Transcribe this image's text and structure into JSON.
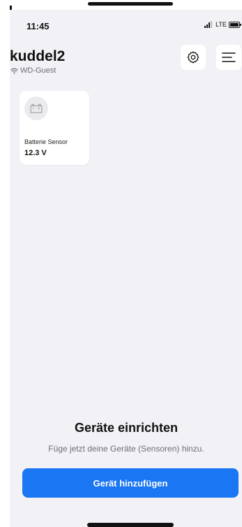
{
  "statusbar": {
    "time": "11:45",
    "network": "LTE"
  },
  "header": {
    "title": "kuddel2",
    "wifi_name": "WD-Guest"
  },
  "devices": [
    {
      "name": "Batterie Sensor",
      "value": "12.3 V",
      "icon": "battery-sensor-icon"
    }
  ],
  "setup": {
    "title": "Geräte einrichten",
    "subtitle": "Füge jetzt deine Geräte (Sensoren) hinzu.",
    "button_label": "Gerät hinzufügen"
  },
  "colors": {
    "accent": "#1a76f2",
    "background": "#f2f2f6",
    "card": "#ffffff",
    "secondary_text": "#6e6e73"
  },
  "icons": {
    "settings": "gear-icon",
    "menu": "hamburger-menu-icon",
    "wifi": "wifi-icon"
  }
}
